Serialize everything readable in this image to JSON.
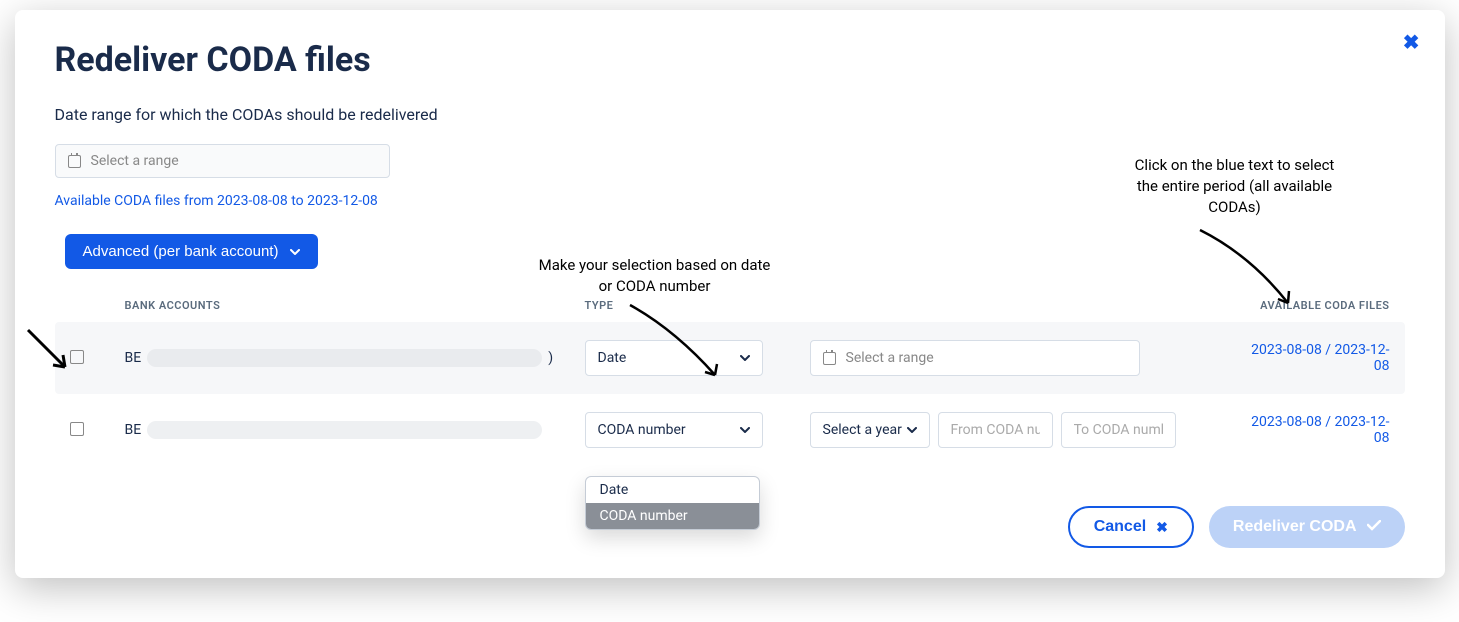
{
  "modal": {
    "title": "Redeliver CODA files",
    "subtitle": "Date range for which the CODAs should be redelivered",
    "range_placeholder": "Select a range",
    "available_link": "Available CODA files from 2023-08-08 to 2023-12-08",
    "advanced_button": "Advanced (per bank account)"
  },
  "table": {
    "headers": {
      "bank_accounts": "BANK ACCOUNTS",
      "type": "TYPE",
      "available": "AVAILABLE CODA FILES"
    },
    "rows": [
      {
        "account_prefix": "BE",
        "account_suffix": ")",
        "type_value": "Date",
        "range_placeholder": "Select a range",
        "available": "2023-08-08 / 2023-12-08"
      },
      {
        "account_prefix": "BE",
        "account_suffix": "",
        "type_value": "CODA number",
        "year_placeholder": "Select a year",
        "from_placeholder": "From CODA number",
        "to_placeholder": "To CODA number",
        "available": "2023-08-08 / 2023-12-08"
      }
    ]
  },
  "dropdown": {
    "options": [
      "Date",
      "CODA number"
    ]
  },
  "footer": {
    "cancel": "Cancel",
    "redeliver": "Redeliver CODA"
  },
  "annotations": {
    "type_note": "Make your selection based on date or CODA number",
    "avail_note": "Click on the blue text to select the entire period (all available CODAs)"
  }
}
